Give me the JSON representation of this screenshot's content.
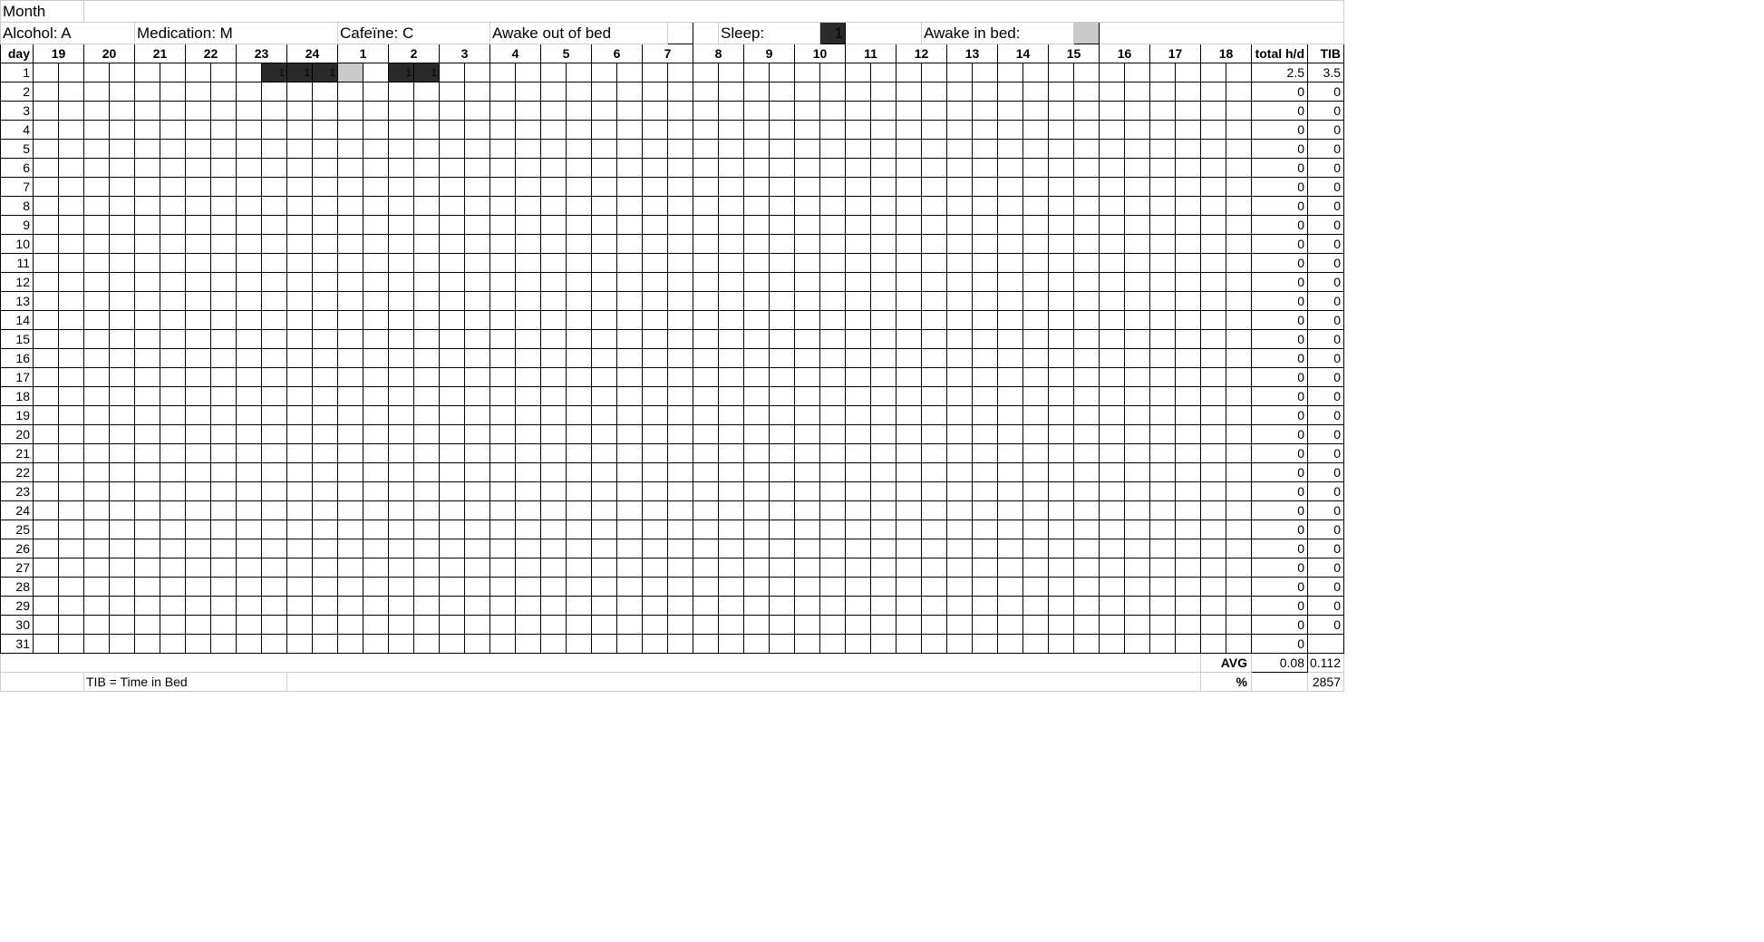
{
  "title_row": {
    "month": "Month"
  },
  "legend": {
    "alcohol": "Alcohol: A",
    "medication": "Medication: M",
    "caffeine": "Cafeïne: C",
    "awake_out": "Awake out of bed",
    "sleep": "Sleep:",
    "sleep_swatch_value": "1",
    "awake_in": "Awake in bed:"
  },
  "headers": {
    "day": "day",
    "hours": [
      "19",
      "20",
      "21",
      "22",
      "23",
      "24",
      "1",
      "2",
      "3",
      "4",
      "5",
      "6",
      "7",
      "8",
      "9",
      "10",
      "11",
      "12",
      "13",
      "14",
      "15",
      "16",
      "17",
      "18"
    ],
    "total": "total h/d",
    "tib": "TIB"
  },
  "rows": [
    {
      "day": "1",
      "cells": [
        null,
        null,
        null,
        null,
        null,
        null,
        null,
        null,
        null,
        "1",
        "1",
        "1",
        "g",
        null,
        "1",
        "1",
        null,
        null,
        null,
        null,
        null,
        null,
        null,
        null,
        null,
        null,
        null,
        null,
        null,
        null,
        null,
        null,
        null,
        null,
        null,
        null,
        null,
        null,
        null,
        null,
        null,
        null,
        null,
        null,
        null,
        null,
        null,
        null
      ],
      "total": "2.5",
      "tib": "3.5"
    },
    {
      "day": "2",
      "cells": [],
      "total": "0",
      "tib": "0"
    },
    {
      "day": "3",
      "cells": [],
      "total": "0",
      "tib": "0"
    },
    {
      "day": "4",
      "cells": [],
      "total": "0",
      "tib": "0"
    },
    {
      "day": "5",
      "cells": [],
      "total": "0",
      "tib": "0"
    },
    {
      "day": "6",
      "cells": [],
      "total": "0",
      "tib": "0"
    },
    {
      "day": "7",
      "cells": [],
      "total": "0",
      "tib": "0"
    },
    {
      "day": "8",
      "cells": [],
      "total": "0",
      "tib": "0"
    },
    {
      "day": "9",
      "cells": [],
      "total": "0",
      "tib": "0"
    },
    {
      "day": "10",
      "cells": [],
      "total": "0",
      "tib": "0"
    },
    {
      "day": "11",
      "cells": [],
      "total": "0",
      "tib": "0"
    },
    {
      "day": "12",
      "cells": [],
      "total": "0",
      "tib": "0"
    },
    {
      "day": "13",
      "cells": [],
      "total": "0",
      "tib": "0"
    },
    {
      "day": "14",
      "cells": [],
      "total": "0",
      "tib": "0"
    },
    {
      "day": "15",
      "cells": [],
      "total": "0",
      "tib": "0"
    },
    {
      "day": "16",
      "cells": [],
      "total": "0",
      "tib": "0"
    },
    {
      "day": "17",
      "cells": [],
      "total": "0",
      "tib": "0"
    },
    {
      "day": "18",
      "cells": [],
      "total": "0",
      "tib": "0"
    },
    {
      "day": "19",
      "cells": [],
      "total": "0",
      "tib": "0"
    },
    {
      "day": "20",
      "cells": [],
      "total": "0",
      "tib": "0"
    },
    {
      "day": "21",
      "cells": [],
      "total": "0",
      "tib": "0"
    },
    {
      "day": "22",
      "cells": [],
      "total": "0",
      "tib": "0"
    },
    {
      "day": "23",
      "cells": [],
      "total": "0",
      "tib": "0"
    },
    {
      "day": "24",
      "cells": [],
      "total": "0",
      "tib": "0"
    },
    {
      "day": "25",
      "cells": [],
      "total": "0",
      "tib": "0"
    },
    {
      "day": "26",
      "cells": [],
      "total": "0",
      "tib": "0"
    },
    {
      "day": "27",
      "cells": [],
      "total": "0",
      "tib": "0"
    },
    {
      "day": "28",
      "cells": [],
      "total": "0",
      "tib": "0"
    },
    {
      "day": "29",
      "cells": [],
      "total": "0",
      "tib": "0"
    },
    {
      "day": "30",
      "cells": [],
      "total": "0",
      "tib": "0"
    },
    {
      "day": "31",
      "cells": [],
      "total": "0",
      "tib": ""
    }
  ],
  "footer": {
    "avg_label": "AVG",
    "avg_total": "0.08",
    "avg_tib": "0.112",
    "pct_label": "%",
    "pct_value": "2857",
    "footnote": "TIB = Time in Bed"
  },
  "colors": {
    "dark": "#2b2b2b",
    "grey": "#c9c9c9"
  }
}
